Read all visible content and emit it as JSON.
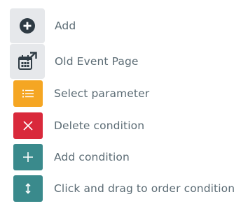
{
  "legend": {
    "items": [
      {
        "id": "add",
        "label": "Add",
        "icon": "plus-circle-icon"
      },
      {
        "id": "old_event_page",
        "label": "Old Event Page",
        "icon": "calendar-external-link-icon"
      },
      {
        "id": "select_parameter",
        "label": "Select parameter",
        "icon": "list-icon",
        "color": "#f5a623"
      },
      {
        "id": "delete_condition",
        "label": "Delete condition",
        "icon": "close-icon",
        "color": "#d9293b"
      },
      {
        "id": "add_condition",
        "label": "Add condition",
        "icon": "plus-icon",
        "color": "#3a8a8c"
      },
      {
        "id": "drag_order",
        "label": "Click and drag to order condition",
        "icon": "drag-vertical-arrows-icon",
        "color": "#3a8a8c"
      }
    ]
  }
}
